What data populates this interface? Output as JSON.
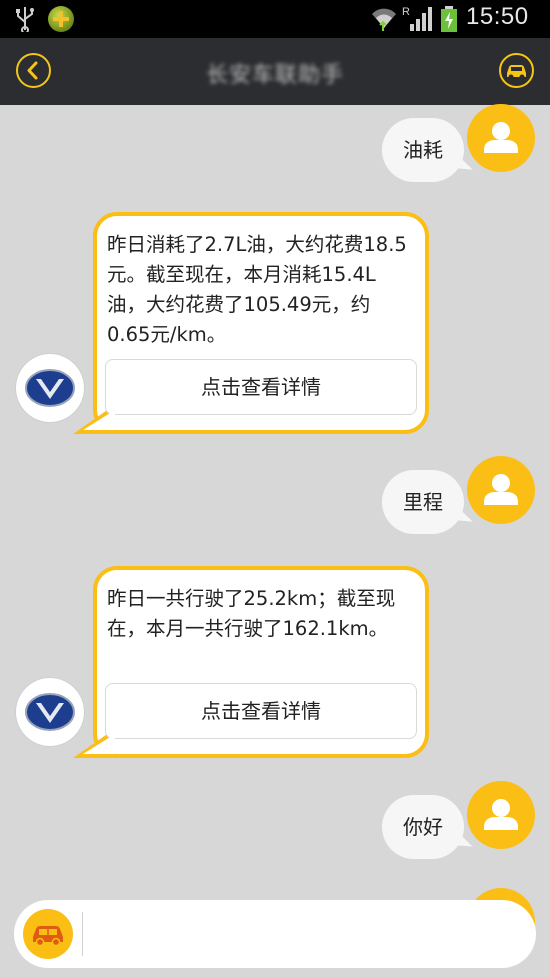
{
  "status_bar": {
    "time": "15:50"
  },
  "header": {
    "title": "长安车联助手"
  },
  "messages": [
    {
      "sender": "user",
      "text": "油耗"
    },
    {
      "sender": "bot",
      "text": "昨日消耗了2.7L油，大约花费18.5元。截至现在，本月消耗15.4L油，大约花费了105.49元，约0.65元/km。",
      "button": "点击查看详情"
    },
    {
      "sender": "user",
      "text": "里程"
    },
    {
      "sender": "bot",
      "text": "昨日一共行驶了25.2km；截至现在，本月一共行驶了162.1km。",
      "button": "点击查看详情"
    },
    {
      "sender": "user",
      "text": "你好"
    }
  ],
  "colors": {
    "accent": "#fbbe14",
    "titlebar": "#2c2d30",
    "background": "#d7d7d7"
  }
}
